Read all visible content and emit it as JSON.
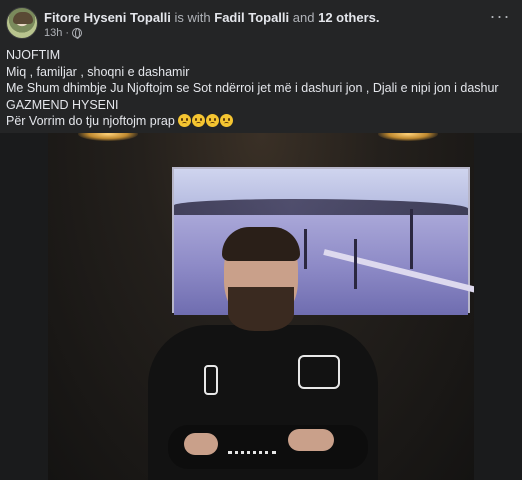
{
  "post": {
    "author": "Fitore Hyseni Topalli",
    "with_text": "is with",
    "tagged": "Fadil Topalli",
    "and_text": "and",
    "others": "12 others.",
    "time": "13h",
    "audience_sep": "·",
    "audience_icon": "globe-icon",
    "more_icon": "more-options-icon",
    "lines": [
      "NJOFTIM",
      "Miq , familjar , shoqni e dashamir",
      "Me Shum dhimbje Ju Njoftojm se Sot ndërroi jet më i dashuri jon , Djali e nipi jon i dashur",
      "GAZMEND HYSENI",
      "Për Vorrim do tju njoftojm prap"
    ],
    "emoji_count": 4,
    "emoji_icon": "crying-face-emoji",
    "photo_alt": "photo-of-young-man-in-black-hoodie"
  },
  "colors": {
    "background": "#242526",
    "text": "#e4e6eb",
    "muted": "#b0b3b8"
  }
}
